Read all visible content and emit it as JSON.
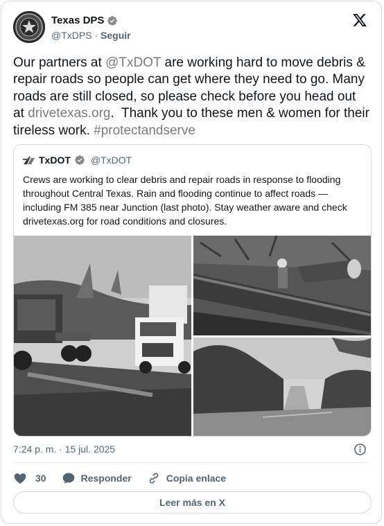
{
  "author": {
    "name": "Texas DPS",
    "handle": "@TxDPS",
    "separator": " · ",
    "follow_label": "Seguir"
  },
  "tweet": {
    "part1": "Our partners at ",
    "mention": "@TxDOT",
    "part2": " are working hard to move debris & repair roads so people can get where they need to go. Many roads are still closed, so please check before you head out at ",
    "url": "drivetexas.org",
    "part3": ".  Thank you to these men & women for their tireless work. ",
    "hashtag": "#protectandserve"
  },
  "quote": {
    "name": "TxDOT",
    "handle": "@TxDOT",
    "text": "Crews are working to clear debris and repair roads in response to flooding throughout Central Texas. Rain and flooding continue to affect roads — including FM 385 near Junction (last photo). Stay weather aware and check drivetexas.org for road conditions and closures."
  },
  "meta": {
    "timestamp": "7:24 p. m. · 15 jul. 2025"
  },
  "actions": {
    "likes": "30",
    "reply_label": "Responder",
    "copy_label": "Copia enlace"
  },
  "read_more_label": "Leer más en X",
  "icons": [
    "x-logo-icon",
    "verified-badge-icon",
    "info-icon",
    "heart-icon",
    "reply-icon",
    "link-icon"
  ],
  "colors": {
    "text": "#0f1419",
    "secondary": "#536471",
    "link": "#7a7a7a",
    "border": "#cfd9de"
  }
}
